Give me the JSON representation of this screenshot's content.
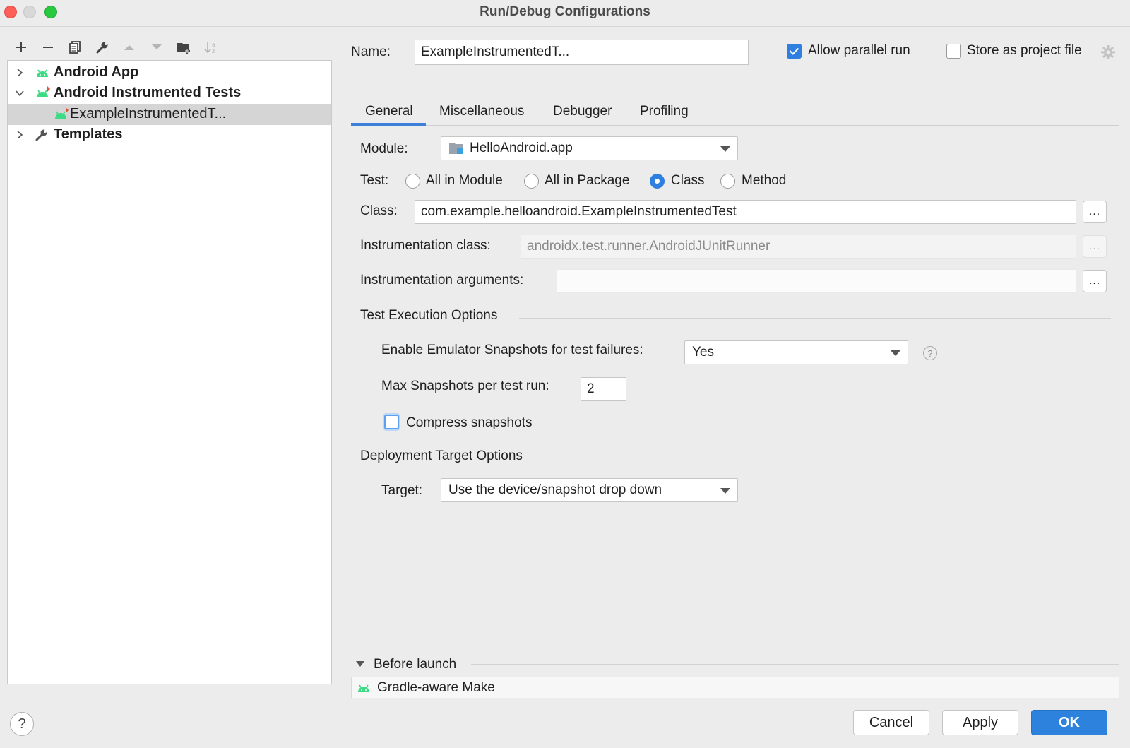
{
  "window": {
    "title": "Run/Debug Configurations"
  },
  "toolbar": {
    "icons": [
      "add-icon",
      "remove-icon",
      "copy-icon",
      "wrench-icon",
      "move-up-icon",
      "move-down-icon",
      "new-folder-icon",
      "sort-icon"
    ]
  },
  "tree": {
    "items": [
      {
        "label": "Android App",
        "expanded": false,
        "bold": true
      },
      {
        "label": "Android Instrumented Tests",
        "expanded": true,
        "bold": true
      },
      {
        "label": "ExampleInstrumentedT...",
        "selected": true,
        "bold": false
      },
      {
        "label": "Templates",
        "expanded": false,
        "bold": true
      }
    ]
  },
  "header": {
    "name_label": "Name:",
    "name_value": "ExampleInstrumentedT...",
    "allow_parallel_label": "Allow parallel run",
    "allow_parallel_checked": true,
    "store_project_label": "Store as project file",
    "store_project_checked": false
  },
  "tabs": [
    {
      "label": "General",
      "active": true
    },
    {
      "label": "Miscellaneous",
      "active": false
    },
    {
      "label": "Debugger",
      "active": false
    },
    {
      "label": "Profiling",
      "active": false
    }
  ],
  "general": {
    "module_label": "Module:",
    "module_value": "HelloAndroid.app",
    "test_label": "Test:",
    "test_options": [
      "All in Module",
      "All in Package",
      "Class",
      "Method"
    ],
    "test_selected": "Class",
    "class_label": "Class:",
    "class_value": "com.example.helloandroid.ExampleInstrumentedTest",
    "instr_class_label": "Instrumentation class:",
    "instr_class_value": "androidx.test.runner.AndroidJUnitRunner",
    "instr_args_label": "Instrumentation arguments:",
    "instr_args_value": "",
    "ellipsis": "...",
    "test_exec_title": "Test Execution Options",
    "snapshots_label": "Enable Emulator Snapshots for test failures:",
    "snapshots_value": "Yes",
    "max_snapshots_label": "Max Snapshots per test run:",
    "max_snapshots_value": "2",
    "compress_label": "Compress snapshots",
    "compress_checked": false,
    "deploy_title": "Deployment Target Options",
    "target_label": "Target:",
    "target_value": "Use the device/snapshot drop down"
  },
  "before_launch": {
    "title": "Before launch",
    "items": [
      "Gradle-aware Make"
    ]
  },
  "footer": {
    "help": "?",
    "cancel": "Cancel",
    "apply": "Apply",
    "ok": "OK"
  },
  "colors": {
    "accent": "#2c82dd",
    "android_green": "#3ddc84",
    "selection": "#d5d5d5"
  }
}
